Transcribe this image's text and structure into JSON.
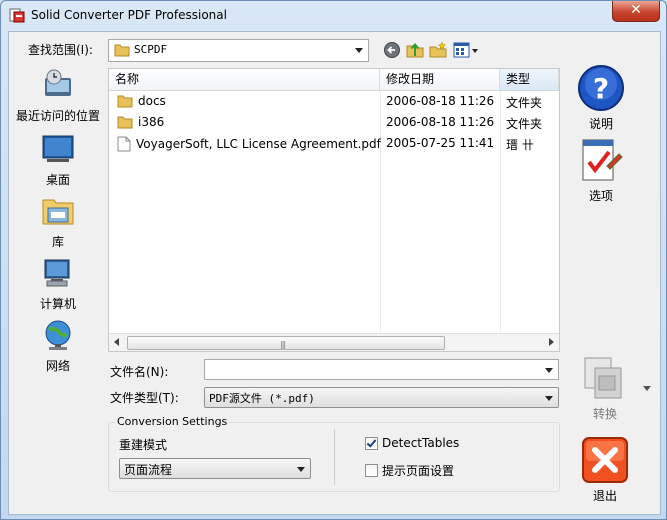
{
  "window": {
    "title": "Solid Converter PDF Professional",
    "close_glyph": "✕"
  },
  "lookin": {
    "label": "查找范围(I):",
    "value": "SCPDF"
  },
  "places": [
    {
      "label": "最近访问的位置",
      "icon": "recent-places-icon"
    },
    {
      "label": "桌面",
      "icon": "desktop-icon"
    },
    {
      "label": "库",
      "icon": "libraries-icon"
    },
    {
      "label": "计算机",
      "icon": "computer-icon"
    },
    {
      "label": "网络",
      "icon": "network-icon"
    }
  ],
  "columns": {
    "name": "名称",
    "modified": "修改日期",
    "type": "类型"
  },
  "files": [
    {
      "name": "docs",
      "modified": "2006-08-18 11:26",
      "type": "文件夹",
      "kind": "folder"
    },
    {
      "name": "i386",
      "modified": "2006-08-18 11:26",
      "type": "文件夹",
      "kind": "folder"
    },
    {
      "name": "VoyagerSoft, LLC License Agreement.pdf",
      "modified": "2005-07-25 11:41",
      "type": "瑨 卄",
      "kind": "file"
    }
  ],
  "scroll_grip": "|||",
  "filename": {
    "label": "文件名(N):",
    "value": ""
  },
  "filetype": {
    "label": "文件类型(T):",
    "value": "PDF源文件 (*.pdf)"
  },
  "settings": {
    "title": "Conversion Settings",
    "mode_label": "重建模式",
    "mode_value": "页面流程",
    "detect_tables": {
      "label": "DetectTables",
      "checked": true
    },
    "page_setup": {
      "label": "提示页面设置",
      "checked": false
    }
  },
  "buttons": {
    "help": "说明",
    "options": "选项",
    "convert": "转换",
    "exit": "退出"
  }
}
